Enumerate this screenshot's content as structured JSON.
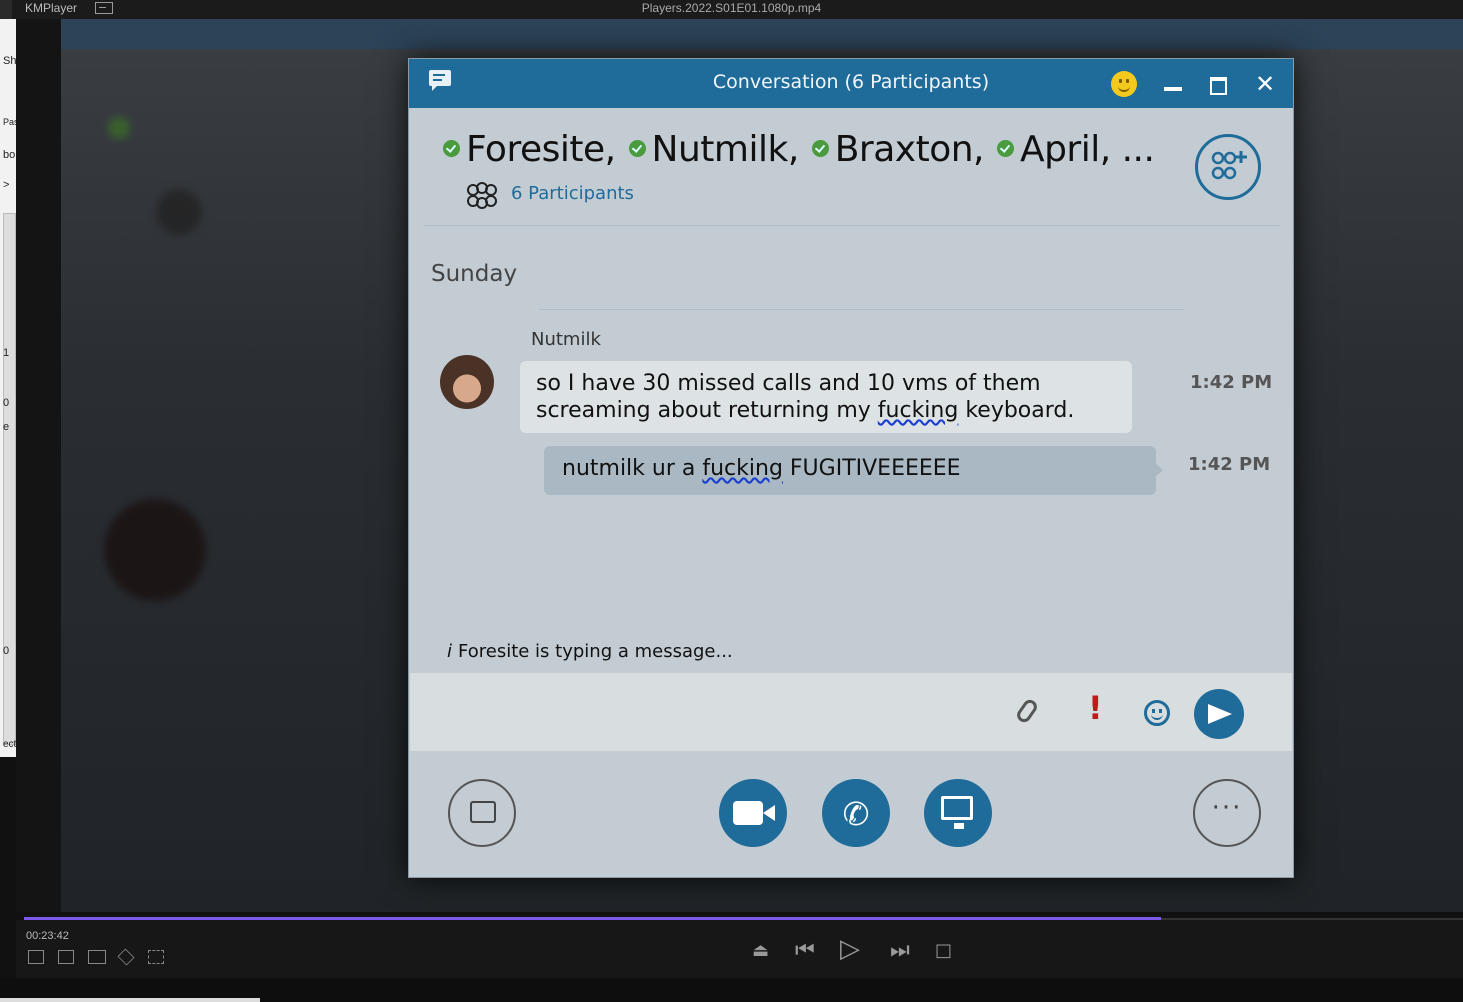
{
  "player": {
    "app_name": "KMPlayer",
    "file_name": "Players.2022.S01E01.1080p.mp4",
    "current_time": "00:23:42",
    "progress_fraction": 0.79
  },
  "side_strip": {
    "labels": [
      "Sh",
      "Past",
      "bo",
      ">",
      "1",
      "0",
      "e",
      "0",
      "ecte"
    ]
  },
  "conversation": {
    "window_title": "Conversation (6 Participants)",
    "participants": [
      {
        "name": "Foresite,"
      },
      {
        "name": "Nutmilk,"
      },
      {
        "name": "Braxton,"
      },
      {
        "name": "April, ..."
      }
    ],
    "participant_count_label": "6 Participants",
    "day_label": "Sunday",
    "sender": "Nutmilk",
    "messages": [
      {
        "text_a": "so I have 30 missed calls and 10 vms of them",
        "text_b": "screaming about returning my ",
        "underlined": "fucking",
        "text_c": " keyboard.",
        "time": "1:42 PM"
      },
      {
        "text_a": "nutmilk ur a ",
        "underlined": "fucking",
        "text_c": " FUGITIVEEEEEE",
        "time": "1:42 PM"
      }
    ],
    "typing_indicator": "Foresite is typing a message...",
    "typing_icon": "i",
    "more_label": "···"
  },
  "colors": {
    "accent": "#1f6b9a",
    "online": "#4a9a3e",
    "alert": "#c21a1a",
    "seek": "#7a59e8"
  },
  "icons": {
    "chat": "chat-icon",
    "emoji": "emoji-icon",
    "minimize": "minimize-icon",
    "maximize": "maximize-icon",
    "close": "close-icon",
    "add_participant": "add-participant-icon",
    "attachment": "paperclip-icon",
    "importance": "exclamation-icon",
    "send": "send-icon",
    "video": "video-camera-icon",
    "call": "phone-icon",
    "share": "share-screen-icon",
    "more": "more-options-icon"
  }
}
